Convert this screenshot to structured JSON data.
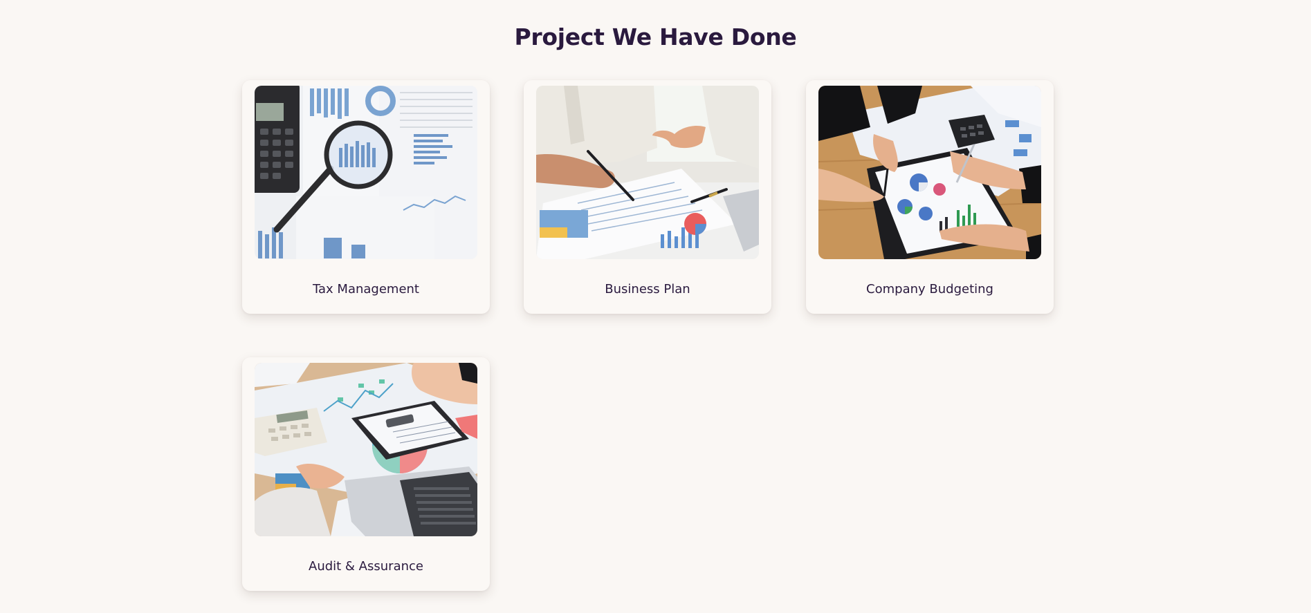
{
  "section": {
    "title": "Project We Have Done"
  },
  "projects": [
    {
      "label": "Tax Management",
      "image_subject": "calculator-magnifier-charts"
    },
    {
      "label": "Business Plan",
      "image_subject": "hands-pen-documents"
    },
    {
      "label": "Company Budgeting",
      "image_subject": "team-clipboard-charts"
    },
    {
      "label": "Audit & Assurance",
      "image_subject": "laptop-calculator-reports"
    }
  ],
  "colors": {
    "background": "#faf7f4",
    "card": "#fbf8f5",
    "title": "#2a1a3e",
    "chart_blue": "#5b8fd0",
    "wood": "#c8955a"
  }
}
